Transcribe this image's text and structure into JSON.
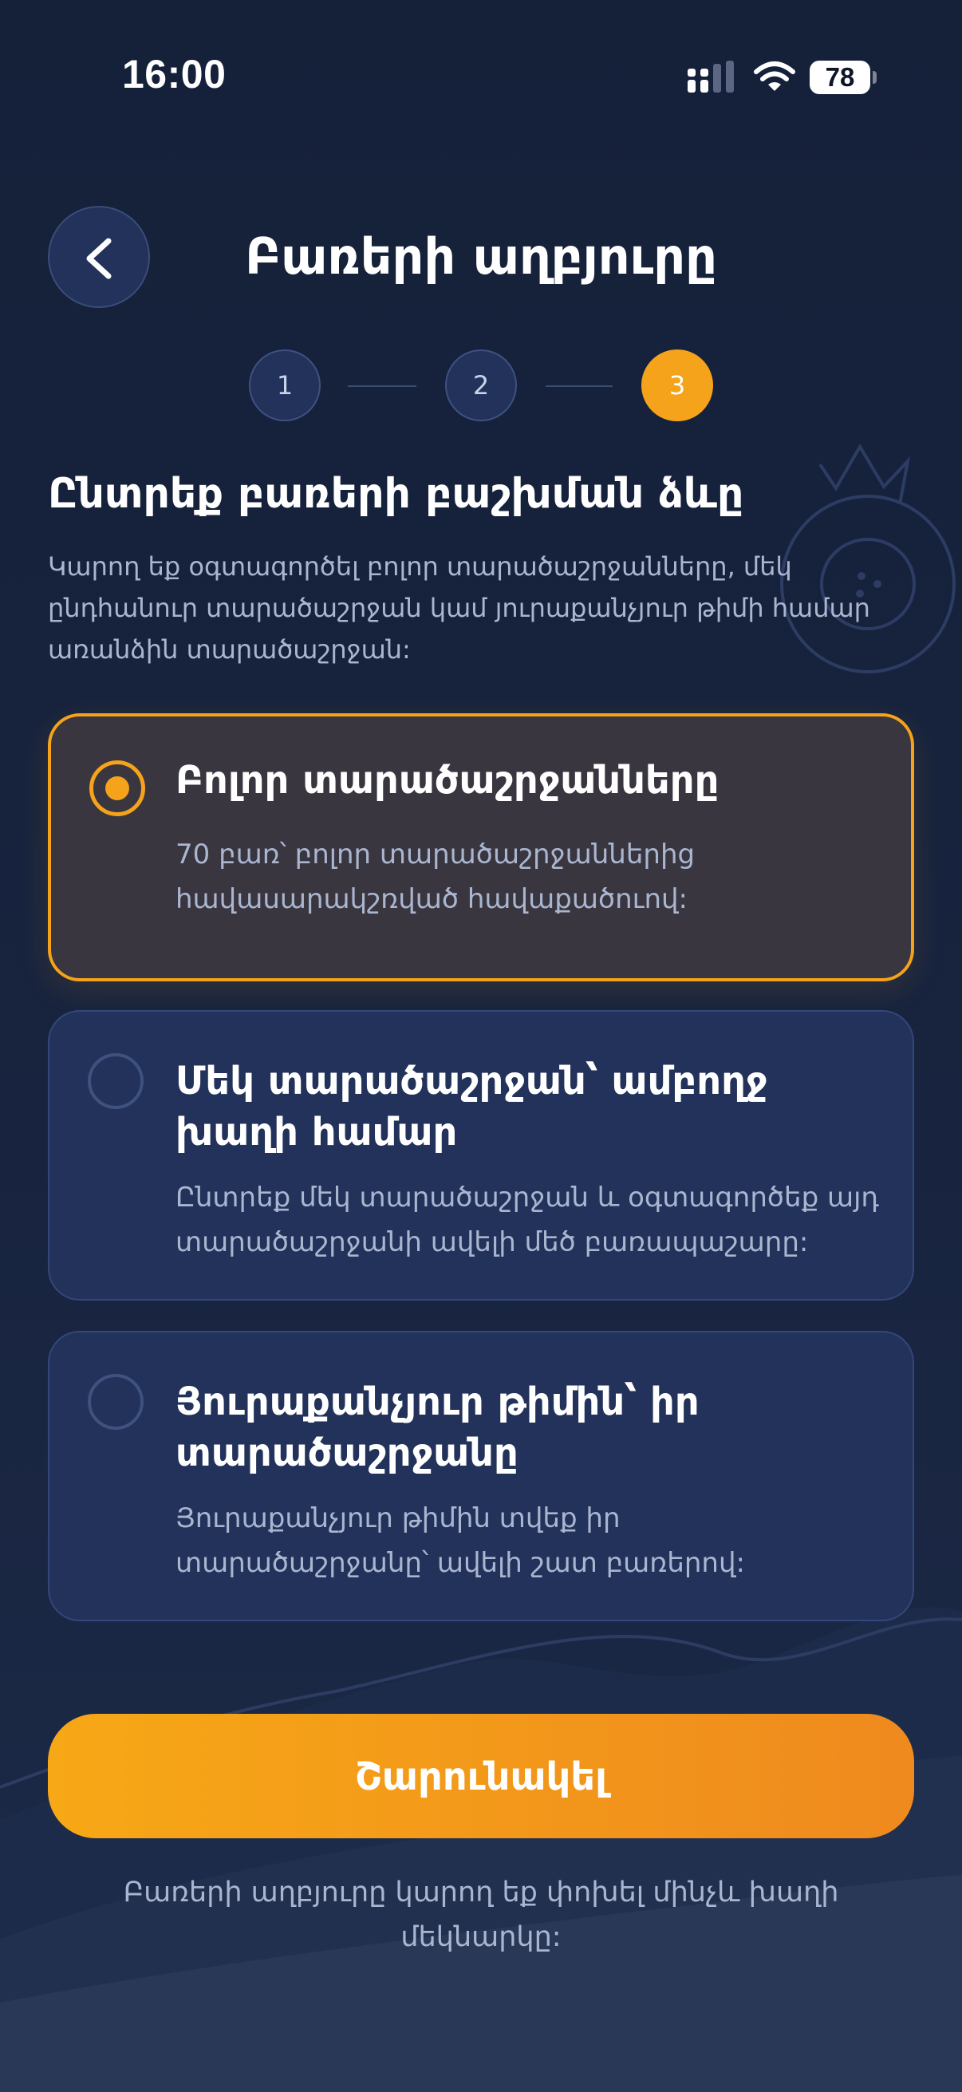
{
  "status_bar": {
    "time": "16:00",
    "battery": "78",
    "icons": [
      "signal-icon",
      "wifi-icon",
      "battery-icon"
    ]
  },
  "header": {
    "title": "Բառերի աղբյուրը",
    "back_icon": "chevron-left-icon"
  },
  "stepper": {
    "steps": [
      {
        "label": "1",
        "state": "inactive"
      },
      {
        "label": "2",
        "state": "inactive"
      },
      {
        "label": "3",
        "state": "active"
      }
    ]
  },
  "section": {
    "title": "Ընտրեք բառերի բաշխման ձևը",
    "description": "Կարող եք օգտագործել բոլոր տարածաշրջանները, մեկ ընդհանուր տարածաշրջան կամ յուրաքանչյուր թիմի համար առանձին տարածաշրջան:"
  },
  "options": [
    {
      "title": "Բոլոր տարածաշրջանները",
      "description": "70 բառ՝ բոլոր տարածաշրջաններից հավասարակշռված հավաքածուով:",
      "selected": true
    },
    {
      "title": "Մեկ տարածաշրջան՝ ամբողջ խաղի համար",
      "description": "Ընտրեք մեկ տարածաշրջան և օգտագործեք այդ տարածաշրջանի ավելի մեծ բառապաշարը:",
      "selected": false
    },
    {
      "title": "Յուրաքանչյուր թիմին՝ իր տարածաշրջանը",
      "description": "Յուրաքանչյուր թիմին տվեք իր տարածաշրջանը՝ ավելի շատ բառերով:",
      "selected": false
    }
  ],
  "actions": {
    "continue_label": "Շարունակել"
  },
  "footer": {
    "note": "Բառերի աղբյուրը կարող եք փոխել մինչև խաղի մեկնարկը:"
  },
  "colors": {
    "background": "#16213b",
    "card": "#22325a",
    "card_selected": "#3a3640",
    "accent": "#f5a31a",
    "text_muted": "#aab6d0"
  }
}
